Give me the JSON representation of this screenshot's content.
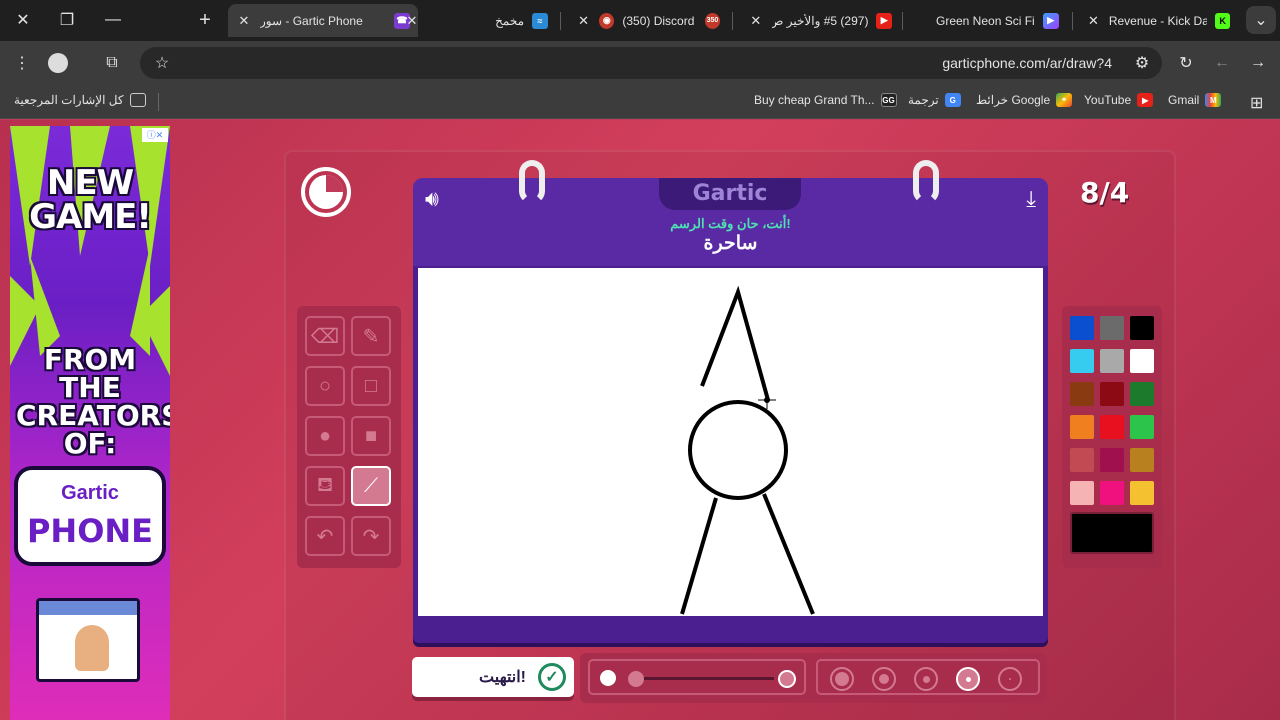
{
  "browser": {
    "tabs": [
      {
        "title": "Gartic Phone - سور",
        "favicon": "phone-icon",
        "active": true
      },
      {
        "title": "مخمخ",
        "favicon": "waveform-icon",
        "active": false
      },
      {
        "title": "(350) Discord |",
        "favicon": "discord-icon",
        "badge": "350",
        "active": false
      },
      {
        "title": "(297) #5 والأخير ص",
        "favicon": "youtube-icon",
        "active": false
      },
      {
        "title": "Green Neon Sci Fi",
        "favicon": "video-icon",
        "active": false
      },
      {
        "title": "Revenue - Kick Das",
        "favicon": "kick-icon",
        "active": false
      }
    ],
    "url": "garticphone.com/ar/draw?4",
    "bookmarks": [
      {
        "label": "كل الإشارات المرجعية",
        "icon": "folder-icon"
      },
      {
        "label": "Buy cheap Grand Th...",
        "icon": "gg-icon"
      },
      {
        "label": "ترجمة",
        "icon": "translate-icon"
      },
      {
        "label": "خرائط Google",
        "icon": "maps-icon"
      },
      {
        "label": "YouTube",
        "icon": "youtube-icon"
      },
      {
        "label": "Gmail",
        "icon": "gmail-icon"
      }
    ]
  },
  "ad": {
    "headline": "NEW GAME!",
    "line2": "FROM THE CREATORS OF:",
    "brand_top": "Gartic",
    "brand_bottom": "PHONE"
  },
  "game": {
    "logo": "Gartic",
    "instruction": "أنت، حان وقت الرسم!",
    "word": "ساحرة",
    "round": "8/4",
    "done_label": "انتهيت!",
    "colors": [
      "#0a4fd0",
      "#6b6b6b",
      "#000000",
      "#36ccf0",
      "#a9a9a9",
      "#ffffff",
      "#8a3a10",
      "#8c0a14",
      "#1c7a2c",
      "#f0801f",
      "#e8101e",
      "#2cc44a",
      "#c24a52",
      "#a0104e",
      "#b8801f",
      "#f6b3b3",
      "#f0107e",
      "#f4c230"
    ],
    "selected_color": "#000000",
    "tool_icons": [
      "eraser-icon",
      "pencil-icon",
      "circle-outline-icon",
      "square-outline-icon",
      "circle-filled-icon",
      "square-filled-icon",
      "fill-bucket-icon",
      "line-tool-icon",
      "undo-icon",
      "redo-icon"
    ],
    "selected_tool": "line-tool-icon"
  }
}
